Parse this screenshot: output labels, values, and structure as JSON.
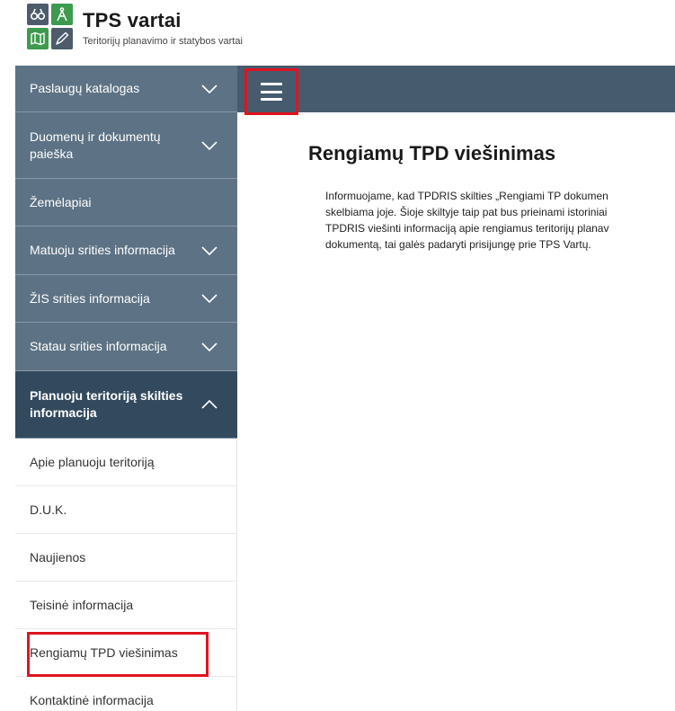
{
  "header": {
    "title": "TPS vartai",
    "subtitle": "Teritorijų planavimo ir statybos vartai",
    "logo_icons": [
      "binoculars-icon",
      "compass-icon",
      "map-icon",
      "pen-icon"
    ],
    "colors": {
      "green": "#3d9a4f",
      "dark": "#4c5c6b"
    }
  },
  "topbar": {
    "menu_icon": "hamburger-menu-icon",
    "color": "#465b6e"
  },
  "sidebar": {
    "items": [
      {
        "label": "Paslaugų katalogas",
        "expandable": true,
        "expanded": false
      },
      {
        "label": "Duomenų ir dokumentų paieška",
        "expandable": true,
        "expanded": false
      },
      {
        "label": "Žemėlapiai",
        "expandable": false,
        "expanded": false
      },
      {
        "label": "Matuoju srities informacija",
        "expandable": true,
        "expanded": false
      },
      {
        "label": "ŽIS srities informacija",
        "expandable": true,
        "expanded": false
      },
      {
        "label": "Statau srities informacija",
        "expandable": true,
        "expanded": false
      },
      {
        "label": "Planuoju teritoriją skilties informacija",
        "expandable": true,
        "expanded": true
      }
    ],
    "sub_items": [
      {
        "label": "Apie planuoju teritoriją"
      },
      {
        "label": "D.U.K."
      },
      {
        "label": "Naujienos"
      },
      {
        "label": "Teisinė informacija"
      },
      {
        "label": "Rengiamų TPD viešinimas",
        "selected": true
      },
      {
        "label": "Kontaktinė informacija"
      }
    ]
  },
  "main": {
    "title": "Rengiamų TPD viešinimas",
    "paragraph_lines": [
      "Informuojame, kad TPDRIS skilties „Rengiami TP dokumen",
      "skelbiama joje. Šioje skiltyje taip pat bus prieinami istoriniai",
      "TPDRIS viešinti informaciją apie rengiamus teritorijų planav",
      "dokumentą, tai galės padaryti prisijungę prie TPS Vartų."
    ]
  },
  "highlight_color": "#e0141e"
}
